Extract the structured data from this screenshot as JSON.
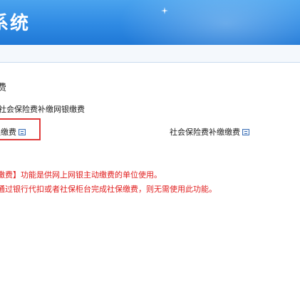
{
  "header": {
    "title": "系统"
  },
  "section": {
    "title": "费"
  },
  "breadcrumb": {
    "text": "社会保险费补缴网银缴费"
  },
  "links": {
    "left_label": "银缴费",
    "right_label": "社会保险费补缴缴费"
  },
  "notice": {
    "line1": "缴费】功能是供网上网银主动缴费的单位使用。",
    "line2": "通过银行代扣或者社保柜台完成社保缴费，则无需使用此功能。"
  },
  "colors": {
    "header_blue": "#2f8ae3",
    "notice_red": "#e11f1f",
    "highlight_red": "#e03a3a",
    "icon_blue": "#3c6fb5"
  },
  "icons": [
    "sparkle-icon",
    "document-icon"
  ]
}
